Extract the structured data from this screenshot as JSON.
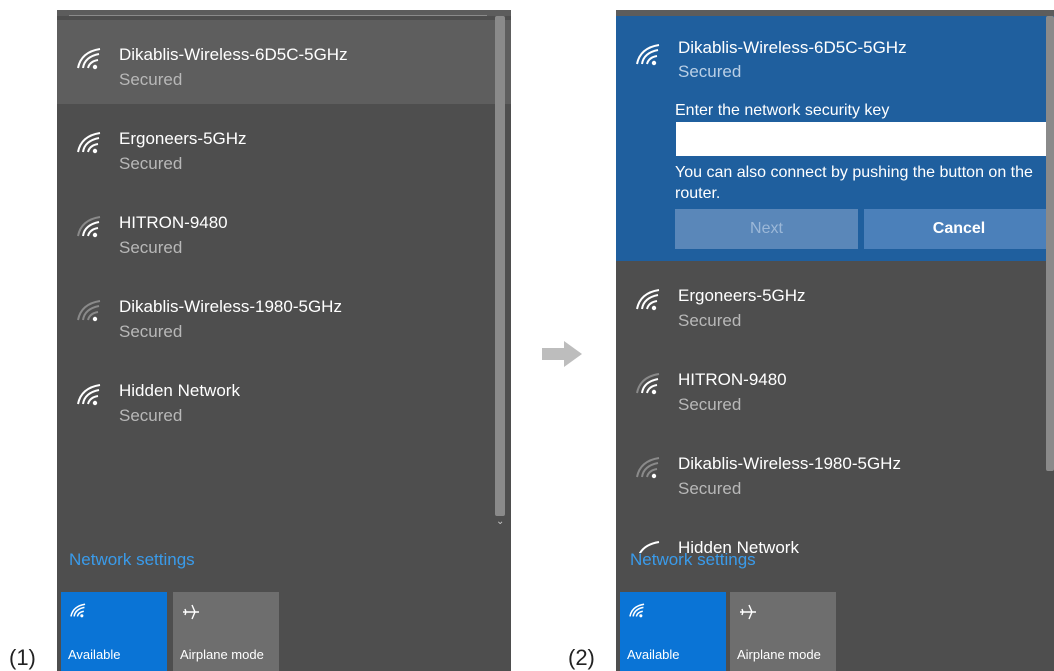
{
  "labels": {
    "panel1": "(1)",
    "panel2": "(2)"
  },
  "panel1": {
    "networks": [
      {
        "name": "Dikablis-Wireless-6D5C-5GHz",
        "status": "Secured",
        "icon": "wifi-strong-icon"
      },
      {
        "name": "Ergoneers-5GHz",
        "status": "Secured",
        "icon": "wifi-strong-icon"
      },
      {
        "name": "HITRON-9480",
        "status": "Secured",
        "icon": "wifi-medium-icon"
      },
      {
        "name": "Dikablis-Wireless-1980-5GHz",
        "status": "Secured",
        "icon": "wifi-weak-icon"
      },
      {
        "name": "Hidden Network",
        "status": "Secured",
        "icon": "wifi-strong-icon"
      }
    ],
    "settings_link": "Network settings",
    "tiles": {
      "available": "Available",
      "airplane": "Airplane mode"
    }
  },
  "panel2": {
    "expanded": {
      "name": "Dikablis-Wireless-6D5C-5GHz",
      "status": "Secured",
      "key_prompt": "Enter the network security key",
      "key_value": "",
      "push_hint": "You can also connect by pushing the button on the router.",
      "next_label": "Next",
      "cancel_label": "Cancel"
    },
    "networks": [
      {
        "name": "Ergoneers-5GHz",
        "status": "Secured",
        "icon": "wifi-strong-icon"
      },
      {
        "name": "HITRON-9480",
        "status": "Secured",
        "icon": "wifi-medium-icon"
      },
      {
        "name": "Dikablis-Wireless-1980-5GHz",
        "status": "Secured",
        "icon": "wifi-weak-icon"
      },
      {
        "name": "Hidden Network",
        "status": "",
        "icon": "wifi-strong-icon"
      }
    ],
    "settings_link": "Network settings",
    "tiles": {
      "available": "Available",
      "airplane": "Airplane mode"
    }
  },
  "colors": {
    "panel_bg": "#4e4e4e",
    "expanded_bg": "#1f5f9e",
    "link": "#3a9bea",
    "available_tile": "#0a74d6"
  }
}
